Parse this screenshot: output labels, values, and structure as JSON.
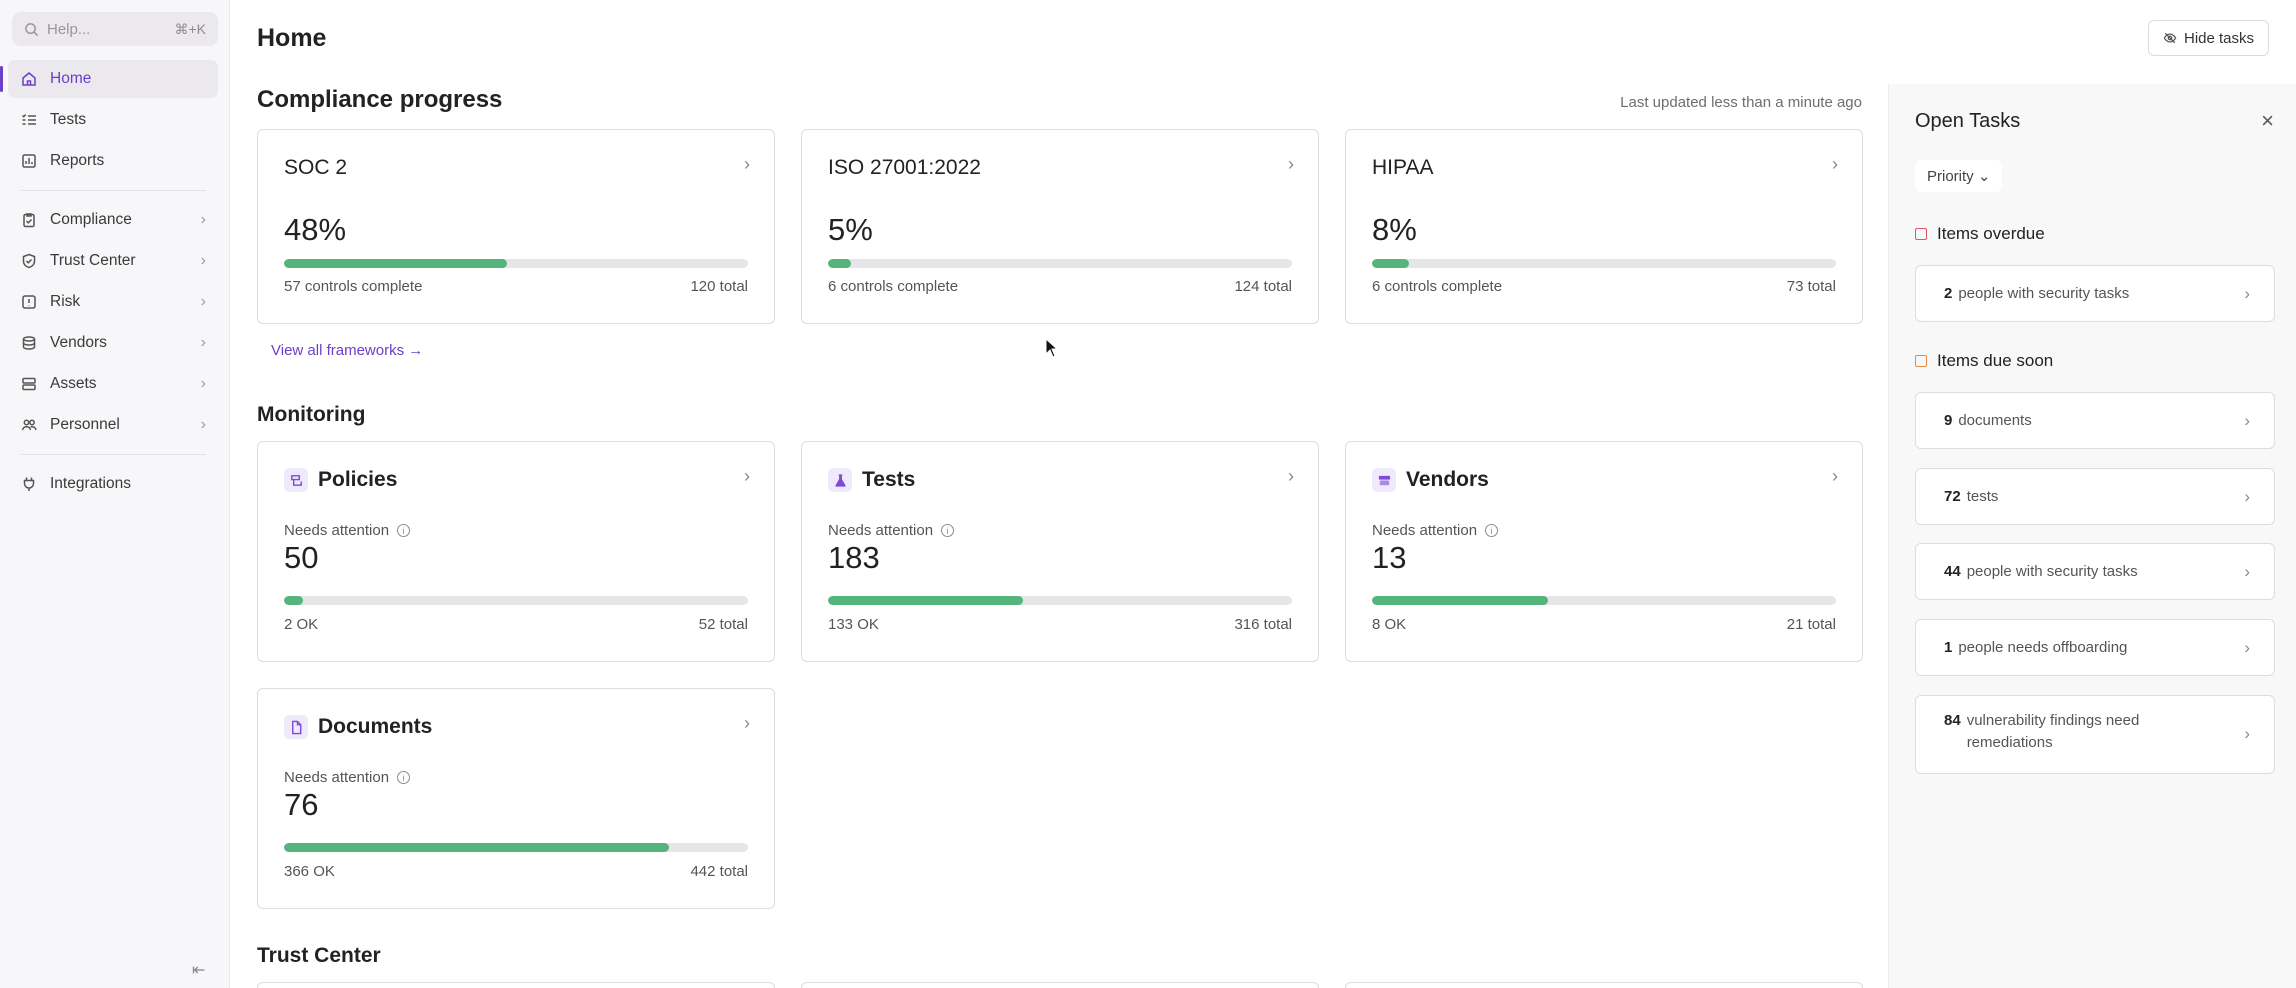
{
  "sidebar": {
    "search_placeholder": "Help...",
    "search_shortcut": "⌘+K",
    "items": [
      {
        "label": "Home",
        "icon": "home-icon"
      },
      {
        "label": "Tests",
        "icon": "list-check-icon"
      },
      {
        "label": "Reports",
        "icon": "report-icon"
      },
      {
        "label": "Compliance",
        "icon": "clipboard-icon"
      },
      {
        "label": "Trust Center",
        "icon": "shield-icon"
      },
      {
        "label": "Risk",
        "icon": "alert-box-icon"
      },
      {
        "label": "Vendors",
        "icon": "stack-icon"
      },
      {
        "label": "Assets",
        "icon": "server-icon"
      },
      {
        "label": "Personnel",
        "icon": "people-icon"
      },
      {
        "label": "Integrations",
        "icon": "plug-icon"
      }
    ]
  },
  "header": {
    "title": "Home",
    "hide_tasks": "Hide tasks"
  },
  "compliance": {
    "title": "Compliance progress",
    "last_updated": "Last updated less than a minute ago",
    "view_all": "View all frameworks",
    "frameworks": [
      {
        "name": "SOC 2",
        "percent_label": "48%",
        "progress": 0.48,
        "complete": "57 controls complete",
        "total": "120 total"
      },
      {
        "name": "ISO 27001:2022",
        "percent_label": "5%",
        "progress": 0.05,
        "complete": "6 controls complete",
        "total": "124 total"
      },
      {
        "name": "HIPAA",
        "percent_label": "8%",
        "progress": 0.08,
        "complete": "6 controls complete",
        "total": "73 total"
      }
    ]
  },
  "monitoring": {
    "title": "Monitoring",
    "needs_label": "Needs attention",
    "cards": [
      {
        "name": "Policies",
        "icon": "policy-icon",
        "count": "50",
        "ok": "2 OK",
        "total": "52 total",
        "progress": 0.04
      },
      {
        "name": "Tests",
        "icon": "flask-icon",
        "count": "183",
        "ok": "133 OK",
        "total": "316 total",
        "progress": 0.42
      },
      {
        "name": "Vendors",
        "icon": "vendor-icon",
        "count": "13",
        "ok": "8 OK",
        "total": "21 total",
        "progress": 0.38
      },
      {
        "name": "Documents",
        "icon": "document-icon",
        "count": "76",
        "ok": "366 OK",
        "total": "442 total",
        "progress": 0.83
      }
    ]
  },
  "trust_center": {
    "title": "Trust Center"
  },
  "tasks": {
    "title": "Open Tasks",
    "priority": "Priority",
    "overdue_title": "Items overdue",
    "overdue": [
      {
        "count": "2",
        "label": "people with security tasks"
      }
    ],
    "due_soon_title": "Items due soon",
    "due_soon": [
      {
        "count": "9",
        "label": "documents"
      },
      {
        "count": "72",
        "label": "tests"
      },
      {
        "count": "44",
        "label": "people with security tasks"
      },
      {
        "count": "1",
        "label": "people needs offboarding"
      },
      {
        "count": "84",
        "label": "vulnerability findings need remediations"
      }
    ]
  },
  "colors": {
    "accent": "#6b3fc9",
    "progress": "#55b37c",
    "overdue": "#e0556a",
    "due_soon": "#e88a3c"
  }
}
